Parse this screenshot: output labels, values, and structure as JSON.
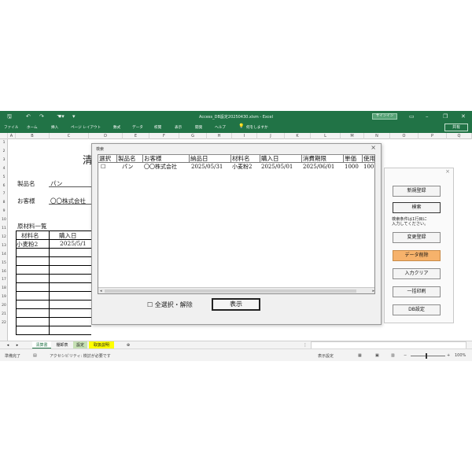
{
  "window": {
    "title": "Access_DB設定20250430.xlsm - Excel",
    "signin_label": "サインイン",
    "share_label": "共有"
  },
  "ribbon_tabs": [
    "ファイル",
    "ホーム",
    "挿入",
    "ページ レイアウト",
    "数式",
    "データ",
    "校閲",
    "表示",
    "開発",
    "ヘルプ",
    "何をしますか"
  ],
  "columns": [
    "A",
    "B",
    "C",
    "D",
    "E",
    "F",
    "G",
    "H",
    "I",
    "J",
    "K",
    "L",
    "M",
    "N",
    "O",
    "P",
    "Q"
  ],
  "rows": [
    "1",
    "2",
    "3",
    "4",
    "5",
    "6",
    "7",
    "8",
    "9",
    "10",
    "11",
    "12",
    "13",
    "14",
    "15",
    "16",
    "17",
    "18",
    "19",
    "20",
    "21",
    "22"
  ],
  "sheet": {
    "title_partial": "清",
    "product_label": "製品名",
    "product_value": "パン",
    "customer_label": "お客様",
    "customer_value": "〇〇株式会社",
    "raw_materials_heading": "原材料一覧",
    "material_col_header": "材料名",
    "purchase_col_header": "購入日",
    "material_row1": "小麦粉2",
    "purchase_row1": "2025/5/1"
  },
  "search_dialog": {
    "caption": "検索",
    "close": "×",
    "headers": [
      "選択",
      "製品名",
      "お客様",
      "納品日",
      "材料名",
      "購入日",
      "消費期限",
      "単価",
      "使用"
    ],
    "row": {
      "select": "☐",
      "product": "パン",
      "customer": "〇〇株式会社",
      "delivery": "2025/05/31",
      "material": "小麦粉2",
      "purchase": "2025/05/01",
      "expiry": "2025/06/01",
      "price": "1000",
      "used": "100"
    },
    "select_all_label": "☐ 全選択・解除",
    "show_button": "表示"
  },
  "side_panel": {
    "close": "×",
    "new_register": "新規登録",
    "search": "検索",
    "hint_line1": "検索条件は1行目に",
    "hint_line2": "入力してください。",
    "change_register": "変更登録",
    "delete_data": "データ削除",
    "input_clear": "入力クリア",
    "batch_print": "一括印刷",
    "db_settings": "DB設定"
  },
  "sheet_tabs": [
    "清算書",
    "棚卸表",
    "設定",
    "取扱説明"
  ],
  "status": {
    "ready": "準備完了",
    "accessibility": "アクセシビリティ: 検討が必要です",
    "display_settings": "表示設定",
    "zoom": "100%"
  },
  "colors": {
    "excel_green": "#217346",
    "delete_button": "#f6b26b",
    "tab_settings": "#c6e0b4",
    "tab_manual": "#ffff00"
  }
}
